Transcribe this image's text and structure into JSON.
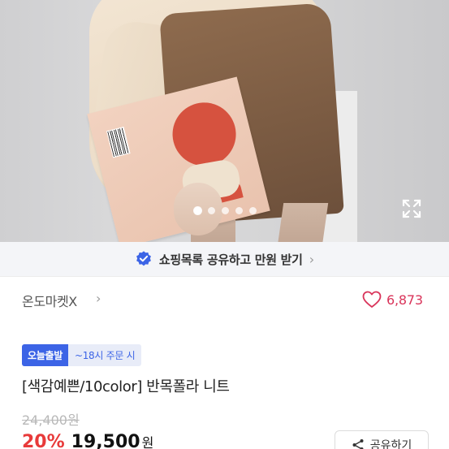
{
  "gallery": {
    "slide_count": 5,
    "active_slide": 1
  },
  "share_banner": {
    "text": "쇼핑목록 공유하고 만원 받기",
    "chevron": "›",
    "icon": "verified-check-icon",
    "accent_color": "#3c64e6"
  },
  "store": {
    "name": "온도마켓X",
    "chevron": "›"
  },
  "likes": {
    "count": "6,873",
    "color": "#d9345a"
  },
  "badges": {
    "today_shipping": "오늘출발",
    "cutoff": "~18시 주문 시"
  },
  "product": {
    "title": "[색감예쁜/10color] 반목폴라 니트",
    "original_price": "24,400원",
    "discount": "20%",
    "sale_price": "19,500",
    "currency": "원"
  },
  "actions": {
    "share_label": "공유하기"
  }
}
